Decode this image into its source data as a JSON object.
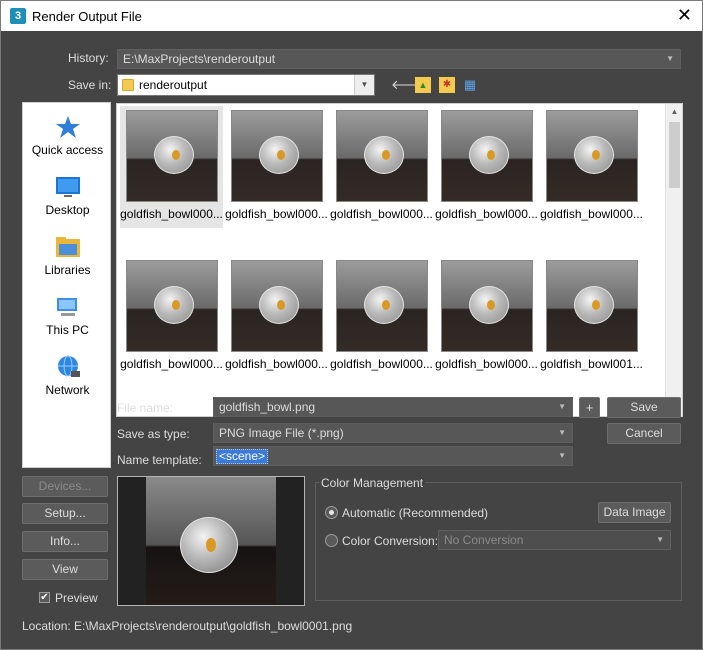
{
  "window": {
    "title": "Render Output File",
    "app_badge": "3",
    "close_glyph": "✕"
  },
  "history": {
    "label": "History:",
    "value": "E:\\MaxProjects\\renderoutput"
  },
  "save_in": {
    "label": "Save in:",
    "value": "renderoutput"
  },
  "toolbar": {
    "back_glyph": "🡐",
    "up_glyph": "▲",
    "new_folder_glyph": "✱",
    "view_glyph": "▦"
  },
  "places": [
    {
      "label": "Quick access",
      "icon": "star-icon"
    },
    {
      "label": "Desktop",
      "icon": "desktop-icon"
    },
    {
      "label": "Libraries",
      "icon": "libraries-icon"
    },
    {
      "label": "This PC",
      "icon": "computer-icon"
    },
    {
      "label": "Network",
      "icon": "network-icon"
    }
  ],
  "files": [
    "goldfish_bowl000...",
    "goldfish_bowl000...",
    "goldfish_bowl000...",
    "goldfish_bowl000...",
    "goldfish_bowl000...",
    "goldfish_bowl000...",
    "goldfish_bowl000...",
    "goldfish_bowl000...",
    "goldfish_bowl000...",
    "goldfish_bowl001..."
  ],
  "file_name": {
    "label": "File name:",
    "value": "goldfish_bowl.png",
    "add_glyph": "+"
  },
  "save_as_type": {
    "label": "Save as type:",
    "value": "PNG Image File (*.png)"
  },
  "name_template": {
    "label": "Name template:",
    "value": "<scene>"
  },
  "buttons": {
    "save": "Save",
    "cancel": "Cancel",
    "devices": "Devices...",
    "setup": "Setup...",
    "info": "Info...",
    "view": "View"
  },
  "preview": {
    "label": "Preview",
    "checked": true,
    "check_glyph": "✔"
  },
  "color_management": {
    "title": "Color Management",
    "automatic_label": "Automatic (Recommended)",
    "data_image_button": "Data Image",
    "conversion_label": "Color Conversion:",
    "conversion_value": "No Conversion"
  },
  "location": {
    "label": "Location:",
    "value": "E:\\MaxProjects\\renderoutput\\goldfish_bowl0001.png"
  },
  "colors": {
    "background": "#444444",
    "accent": "#3b7ad8"
  }
}
